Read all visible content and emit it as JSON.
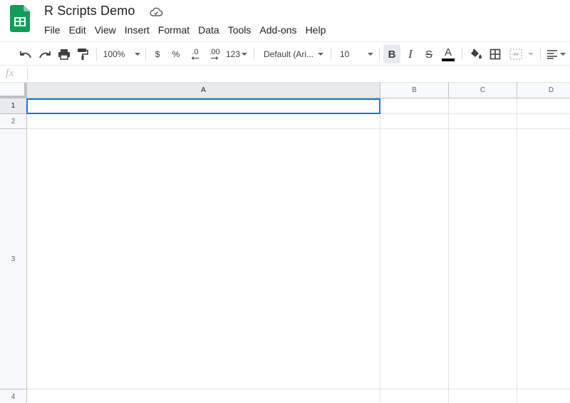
{
  "document": {
    "title": "R Scripts Demo"
  },
  "menu": [
    "File",
    "Edit",
    "View",
    "Insert",
    "Format",
    "Data",
    "Tools",
    "Add-ons",
    "Help"
  ],
  "toolbar": {
    "zoom": "100%",
    "currency": "$",
    "percent": "%",
    "decrease_decimal": ".0",
    "increase_decimal": ".00",
    "more_formats": "123",
    "font": "Default (Ari...",
    "font_size": "10",
    "bold": "B",
    "italic": "I",
    "strikethrough": "S",
    "text_color": "A",
    "icons": [
      "undo-icon",
      "redo-icon",
      "print-icon",
      "paint-format-icon",
      "fill-color-icon",
      "borders-icon",
      "merge-cells-icon",
      "horizontal-align-icon"
    ]
  },
  "formula_bar": {
    "fx": "fx",
    "value": ""
  },
  "grid": {
    "columns": [
      "A",
      "B",
      "C",
      "D"
    ],
    "rows": [
      "1",
      "2",
      "3",
      "4"
    ],
    "selected_cell": "A1"
  },
  "colors": {
    "accent": "#1a73e8",
    "sheets_green": "#0f9d58",
    "header_bg": "#f8f9fa",
    "gridline": "#e2e3e3"
  }
}
